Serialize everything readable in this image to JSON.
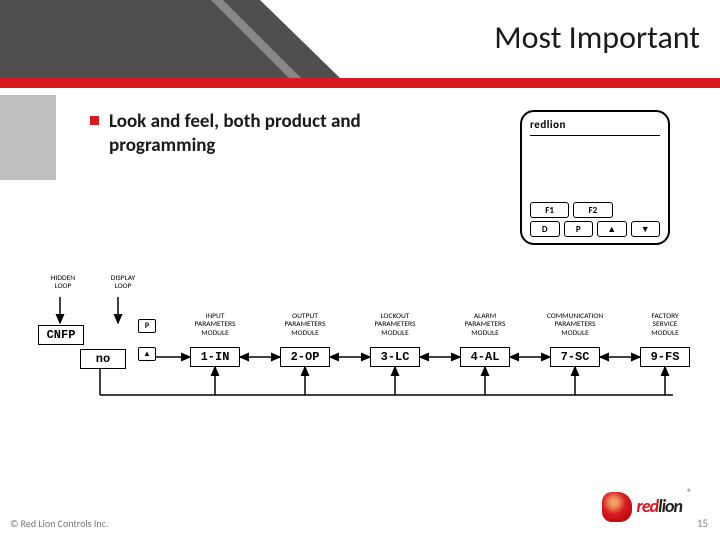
{
  "header": {
    "title": "Most Important"
  },
  "bullet": {
    "text": "Look and feel, both product and programming"
  },
  "device": {
    "brand": "redlion",
    "row1": [
      "F1",
      "F2"
    ],
    "row2": [
      "D",
      "P",
      "▲",
      "▼"
    ]
  },
  "flow": {
    "hidden_loop": "HIDDEN\nLOOP",
    "display_loop": "DISPLAY\nLOOP",
    "cnfp": "CNFP",
    "no": "no",
    "key_p": "P",
    "key_up": "▲",
    "modules": [
      {
        "label": "INPUT\nPARAMETERS\nMODULE",
        "code": "1-IN"
      },
      {
        "label": "OUTPUT\nPARAMETERS\nMODULE",
        "code": "2-OP"
      },
      {
        "label": "LOCKOUT\nPARAMETERS\nMODULE",
        "code": "3-LC"
      },
      {
        "label": "ALARM\nPARAMETERS\nMODULE",
        "code": "4-AL"
      },
      {
        "label": "COMMUNICATION\nPARAMETERS\nMODULE",
        "code": "7-SC"
      },
      {
        "label": "FACTORY\nSERVICE\nMODULE",
        "code": "9-FS"
      }
    ]
  },
  "footer": {
    "copyright": "© Red Lion Controls Inc.",
    "page": "15",
    "logo_red": "red",
    "logo_lion": "lion"
  }
}
